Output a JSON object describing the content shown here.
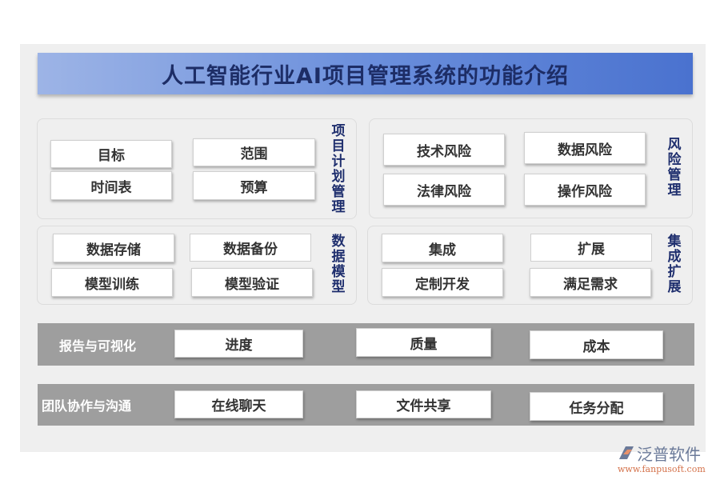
{
  "title": "人工智能行业AI项目管理系统的功能介绍",
  "sections": {
    "project_plan": {
      "label": "项目计划管理",
      "items": [
        "目标",
        "范围",
        "时间表",
        "预算"
      ]
    },
    "risk": {
      "label": "风险管理",
      "items": [
        "技术风险",
        "数据风险",
        "法律风险",
        "操作风险"
      ]
    },
    "data_model": {
      "label": "数据模型",
      "items": [
        "数据存储",
        "数据备份",
        "模型训练",
        "模型验证"
      ]
    },
    "integration": {
      "label": "集成扩展",
      "items": [
        "集成",
        "扩展",
        "定制开发",
        "满足需求"
      ]
    },
    "reporting": {
      "label": "报告与可视化",
      "items": [
        "进度",
        "质量",
        "成本"
      ]
    },
    "team": {
      "label": "团队协作与沟通",
      "items": [
        "在线聊天",
        "文件共享",
        "任务分配"
      ]
    }
  },
  "watermark": {
    "name": "泛普软件",
    "url": "www.fanpusoft.com"
  },
  "colors": {
    "title_text": "#1d2d66",
    "label_text": "#1f2f6e",
    "band": "#9e9e9e"
  }
}
